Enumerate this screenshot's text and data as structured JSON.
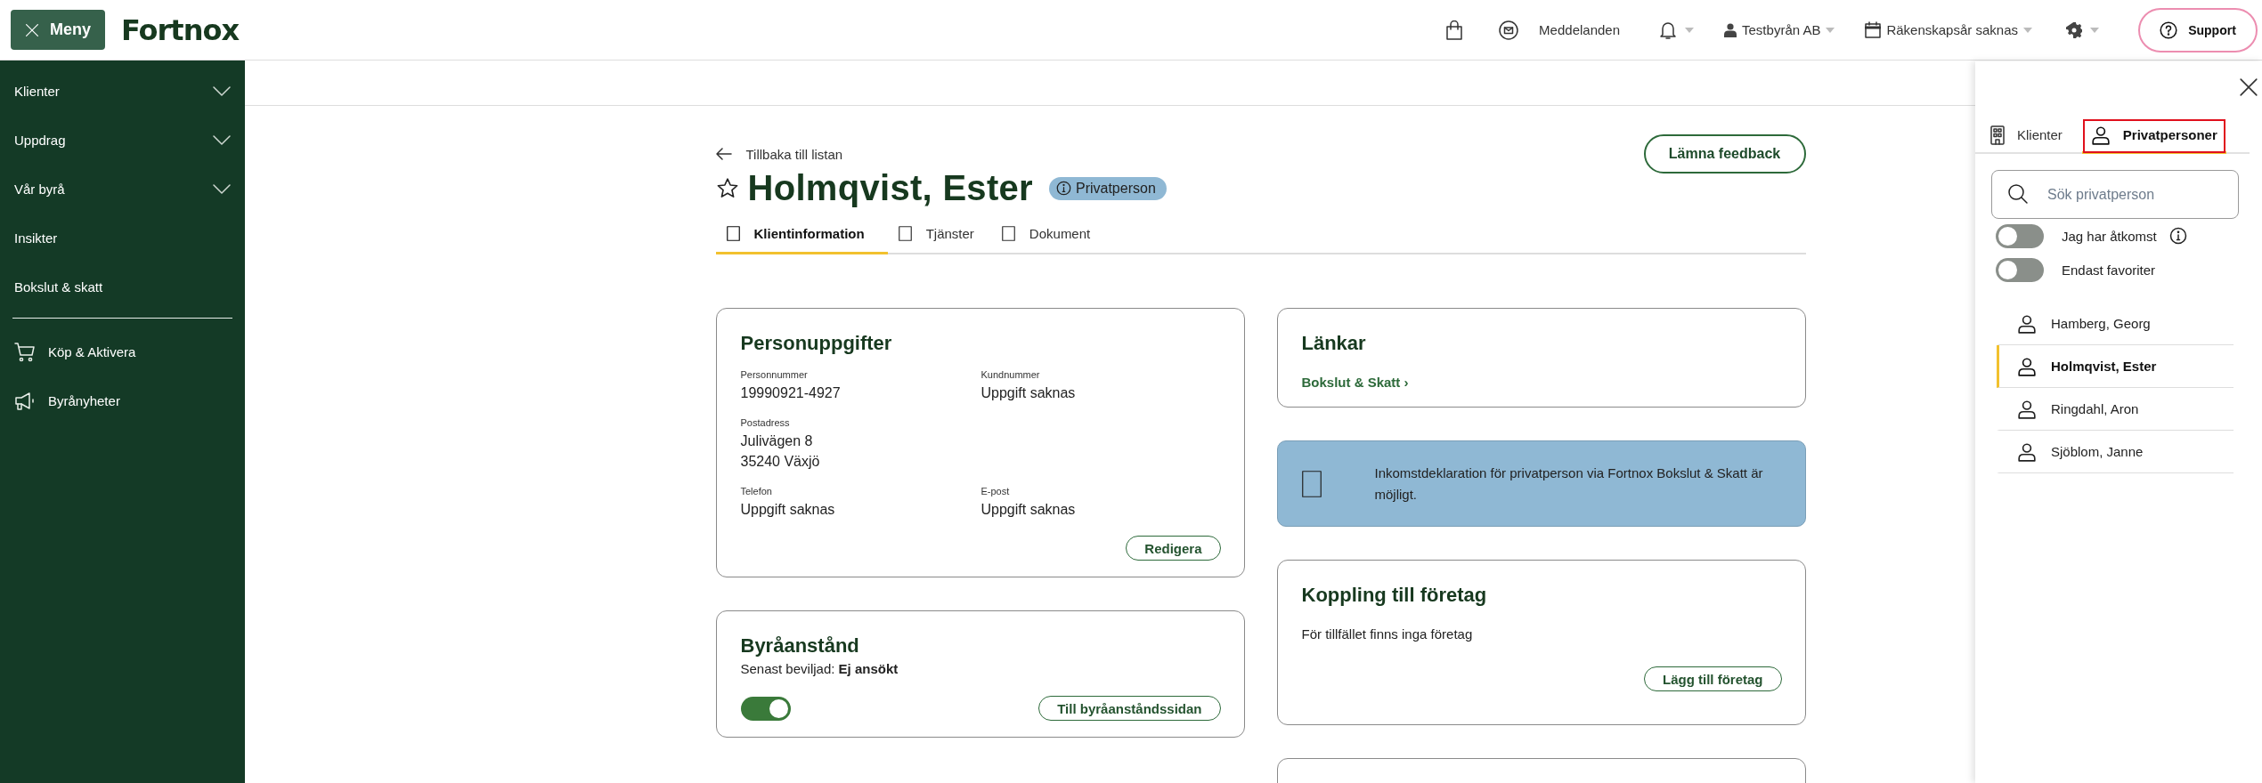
{
  "topbar": {
    "menu_label": "Meny",
    "logo": "Fortnox",
    "messages": "Meddelanden",
    "company": "Testbyrån AB",
    "fiscal_year": "Räkenskapsår saknas",
    "support": "Support"
  },
  "sidebar": {
    "items": [
      {
        "label": "Klienter",
        "kind": "group"
      },
      {
        "label": "Uppdrag",
        "kind": "group"
      },
      {
        "label": "Vår byrå",
        "kind": "group"
      },
      {
        "label": "Insikter",
        "kind": "link"
      },
      {
        "label": "Bokslut & skatt",
        "kind": "link"
      }
    ],
    "extra_items": [
      {
        "label": "Köp & Aktivera",
        "kind": "cart"
      },
      {
        "label": "Byrånyheter",
        "kind": "megaphone"
      }
    ]
  },
  "page": {
    "back_link": "Tillbaka till listan",
    "feedback_button": "Lämna feedback",
    "title": "Holmqvist, Ester",
    "favorite": false,
    "badge": "Privatperson",
    "tabs": [
      {
        "label": "Klientinformation",
        "selected": true
      },
      {
        "label": "Tjänster",
        "selected": false
      },
      {
        "label": "Dokument",
        "selected": false
      }
    ]
  },
  "personal_card": {
    "title": "Personuppgifter",
    "rows": [
      [
        {
          "label": "Personnummer",
          "lines": [
            "19990921-4927"
          ]
        },
        {
          "label": "Kundnummer",
          "lines": [
            "Uppgift saknas"
          ]
        }
      ],
      [
        {
          "label": "Postadress",
          "lines": [
            "Julivägen 8",
            "35240 Växjö"
          ]
        }
      ],
      [
        {
          "label": "Telefon",
          "lines": [
            "Uppgift saknas"
          ]
        },
        {
          "label": "E-post",
          "lines": [
            "Uppgift saknas"
          ]
        }
      ]
    ],
    "edit_button": "Redigera"
  },
  "deferral_card": {
    "title": "Byråanstånd",
    "status": "Senast beviljad: **Ej ansökt**",
    "toggle_on": true,
    "button": "Till byråanståndssidan"
  },
  "links_card": {
    "title": "Länkar",
    "link": "Bokslut & Skatt ›"
  },
  "info_banner": {
    "text": "Inkomstdeklaration för privatperson via Fortnox Bokslut & Skatt är möjligt."
  },
  "company_card": {
    "title": "Koppling till företag",
    "empty_text": "För tillfället finns inga företag",
    "button": "Lägg till företag"
  },
  "panel": {
    "tabs": [
      {
        "label": "Klienter",
        "kind": "building",
        "selected": false,
        "highlighted": false
      },
      {
        "label": "Privatpersoner",
        "kind": "person",
        "selected": true,
        "highlighted": true
      }
    ],
    "search": {
      "placeholder": "Sök privatperson"
    },
    "filters": [
      {
        "label": "Jag har åtkomst",
        "on": false,
        "info": true
      },
      {
        "label": "Endast favoriter",
        "on": false,
        "info": false
      }
    ],
    "people": [
      {
        "name": "Hamberg, Georg",
        "selected": false
      },
      {
        "name": "Holmqvist, Ester",
        "selected": true
      },
      {
        "name": "Ringdahl, Aron",
        "selected": false
      },
      {
        "name": "Sjöblom, Janne",
        "selected": false
      }
    ]
  }
}
